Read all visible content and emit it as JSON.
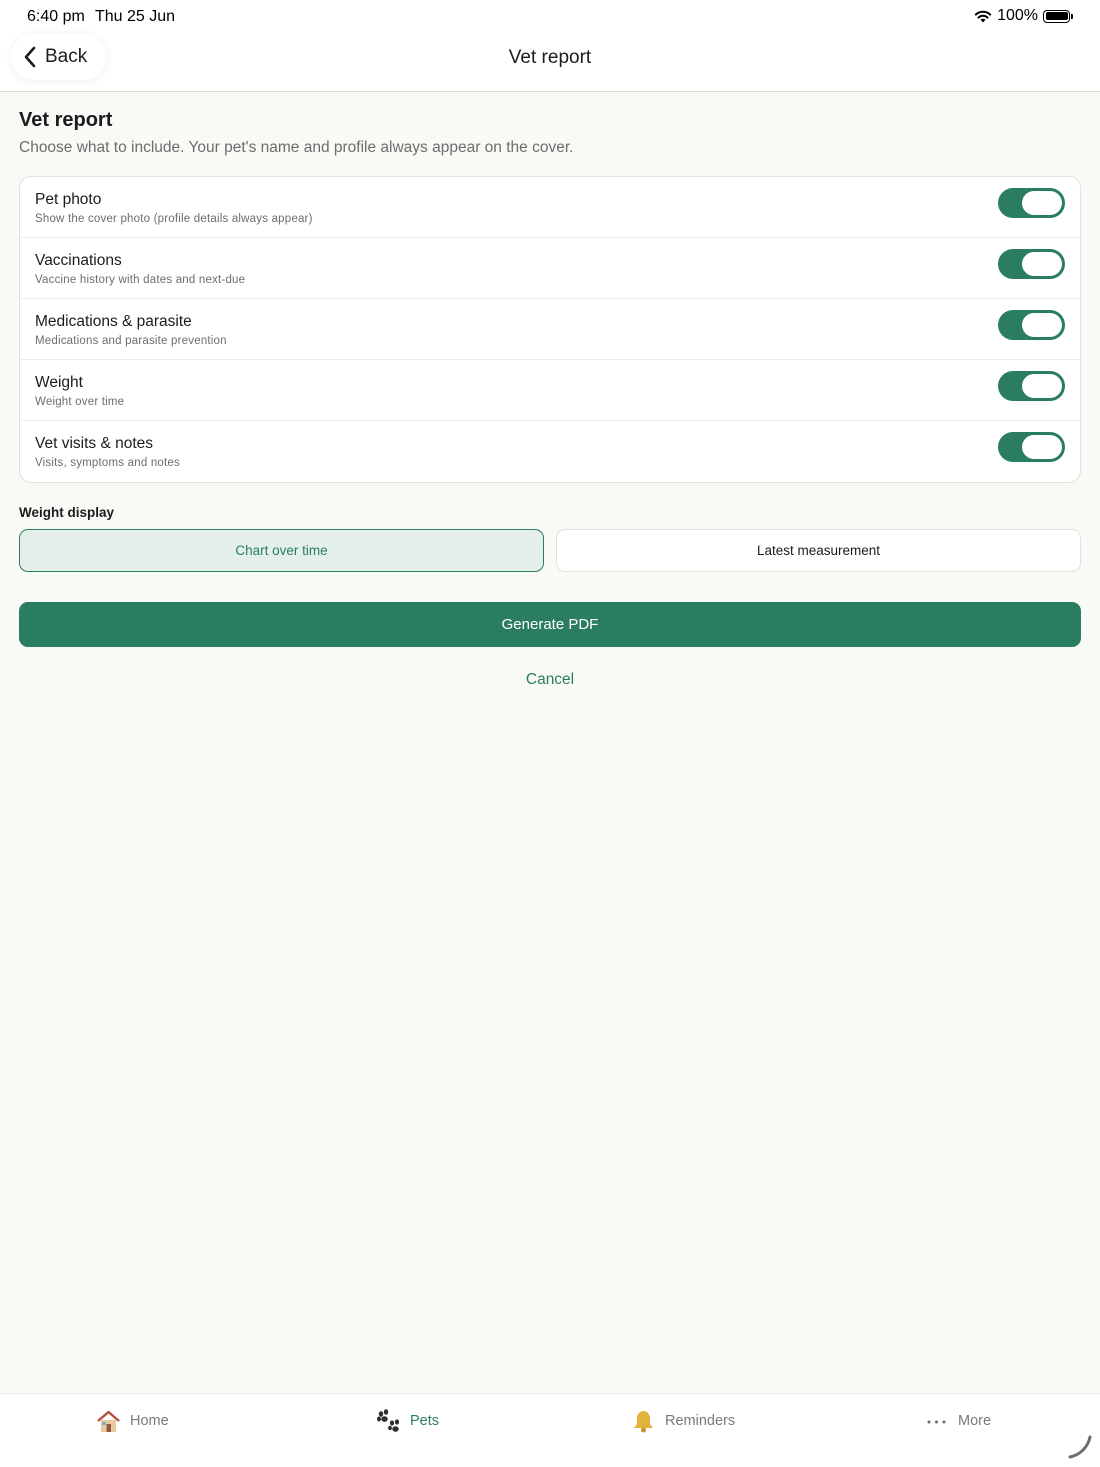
{
  "status_bar": {
    "time": "6:40 pm",
    "date": "Thu 25 Jun",
    "battery": "100%"
  },
  "nav": {
    "back_label": "Back",
    "title": "Vet report"
  },
  "header": {
    "title": "Vet report",
    "subtitle": "Choose what to include. Your pet's name and profile always appear on the cover."
  },
  "options": [
    {
      "title": "Pet photo",
      "description": "Show the cover photo (profile details always appear)",
      "enabled": true
    },
    {
      "title": "Vaccinations",
      "description": "Vaccine history with dates and next-due",
      "enabled": true
    },
    {
      "title": "Medications & parasite",
      "description": "Medications and parasite prevention",
      "enabled": true
    },
    {
      "title": "Weight",
      "description": "Weight over time",
      "enabled": true
    },
    {
      "title": "Vet visits & notes",
      "description": "Visits, symptoms and notes",
      "enabled": true
    }
  ],
  "weight_display": {
    "label": "Weight display",
    "options": [
      "Chart over time",
      "Latest measurement"
    ],
    "selected": "Chart over time"
  },
  "actions": {
    "generate_label": "Generate PDF",
    "cancel_label": "Cancel"
  },
  "tabs": [
    {
      "label": "Home",
      "icon": "house-icon",
      "active": false
    },
    {
      "label": "Pets",
      "icon": "paw-icon",
      "active": true
    },
    {
      "label": "Reminders",
      "icon": "bell-icon",
      "active": false
    },
    {
      "label": "More",
      "icon": "more-icon",
      "active": false
    }
  ],
  "colors": {
    "accent": "#2a7d60",
    "background": "#f9f9f6",
    "selected_segment_bg": "#e4efe9"
  }
}
